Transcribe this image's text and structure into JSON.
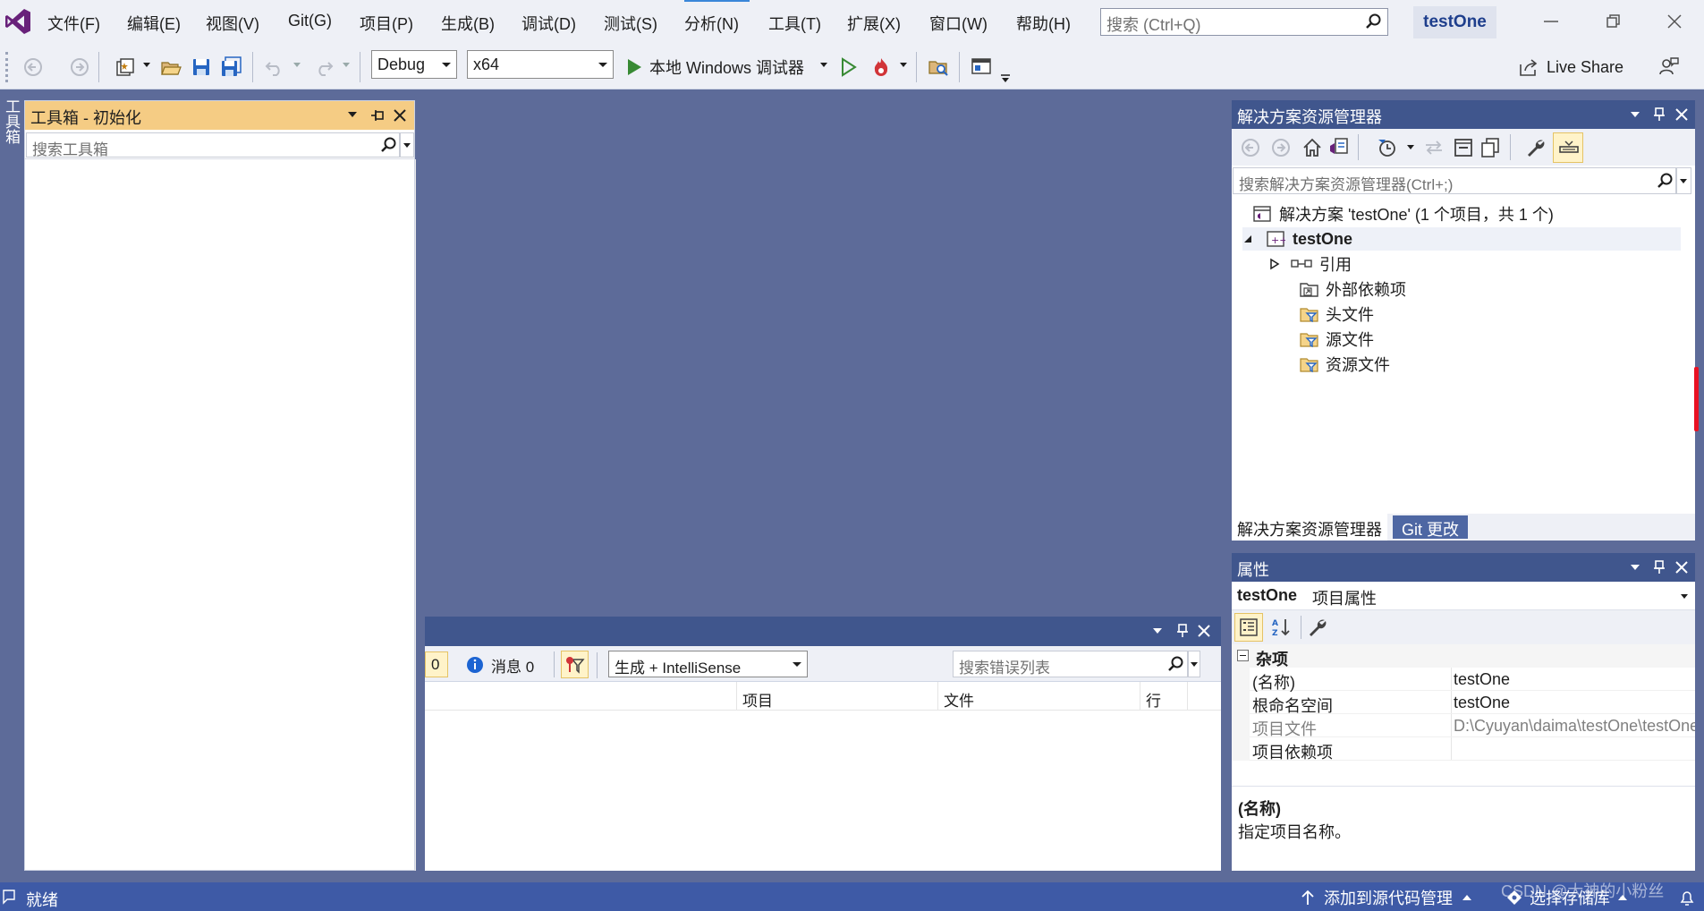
{
  "menu": {
    "items": [
      "文件(F)",
      "编辑(E)",
      "视图(V)",
      "Git(G)",
      "项目(P)",
      "生成(B)",
      "调试(D)",
      "测试(S)",
      "分析(N)",
      "工具(T)",
      "扩展(X)",
      "窗口(W)",
      "帮助(H)"
    ],
    "search_placeholder": "搜索 (Ctrl+Q)",
    "solution_name": "testOne"
  },
  "toolbar": {
    "config": "Debug",
    "platform": "x64",
    "run_label": "本地 Windows 调试器",
    "live_share": "Live Share"
  },
  "toolbox": {
    "side_tab": "工具箱",
    "title": "工具箱 - 初始化",
    "search_placeholder": "搜索工具箱"
  },
  "error_list": {
    "count_partial": "0",
    "messages": "消息 0",
    "filter_option": "生成 + IntelliSense",
    "search_placeholder": "搜索错误列表",
    "columns": [
      "项目",
      "文件",
      "行"
    ]
  },
  "solution_explorer": {
    "title": "解决方案资源管理器",
    "search_placeholder": "搜索解决方案资源管理器(Ctrl+;)",
    "solution_line": "解决方案 'testOne' (1 个项目，共 1 个)",
    "project": "testOne",
    "nodes": [
      "引用",
      "外部依赖项",
      "头文件",
      "源文件",
      "资源文件"
    ],
    "tabs": [
      "解决方案资源管理器",
      "Git 更改"
    ]
  },
  "properties": {
    "title": "属性",
    "object_name": "testOne",
    "object_type": "项目属性",
    "category": "杂项",
    "rows": [
      {
        "key": "(名称)",
        "value": "testOne"
      },
      {
        "key": "根命名空间",
        "value": "testOne"
      },
      {
        "key": "项目文件",
        "value": "D:\\Cyuyan\\daima\\testOne\\testOne.vcxproj"
      },
      {
        "key": "项目依赖项",
        "value": ""
      }
    ],
    "desc_title": "(名称)",
    "desc_text": "指定项目名称。"
  },
  "status": {
    "ready": "就绪",
    "add_source": "添加到源代码管理",
    "select_repo": "选择存储库",
    "watermark": "CSDN @大神的小粉丝"
  },
  "colors": {
    "background": "#5d6b99",
    "chrome": "#eef0f6",
    "panel_title_active": "#f5cc84",
    "panel_title": "#40568d",
    "statusbar": "#3e5aa6",
    "accent_purple": "#68217a"
  }
}
